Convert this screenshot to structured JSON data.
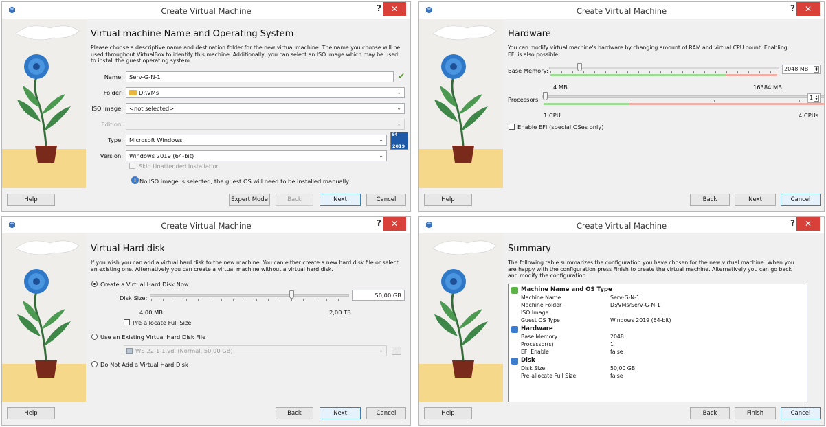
{
  "common": {
    "title": "Create Virtual Machine",
    "help_glyph": "?",
    "close_glyph": "✕",
    "help_button": "Help",
    "back_button": "Back",
    "next_button": "Next",
    "cancel_button": "Cancel",
    "expert_button": "Expert Mode",
    "finish_button": "Finish"
  },
  "w1": {
    "heading": "Virtual machine Name and Operating System",
    "description": "Please choose a descriptive name and destination folder for the new virtual machine. The name you choose will be used throughout VirtualBox to identify this machine. Additionally, you can select an ISO image which may be used to install the guest operating system.",
    "name_label": "Name:",
    "name_value": "Serv-G-N-1",
    "folder_label": "Folder:",
    "folder_value": "D:\\VMs",
    "iso_label": "ISO Image:",
    "iso_value": "<not selected>",
    "edition_label": "Edition:",
    "type_label": "Type:",
    "type_value": "Microsoft Windows",
    "version_label": "Version:",
    "version_value": "Windows 2019 (64-bit)",
    "os_badge_top": "64",
    "os_badge_bottom": "2019",
    "skip_label": "Skip Unattended Installation",
    "info_text": "No ISO image is selected, the guest OS will need to be installed manually."
  },
  "w2": {
    "heading": "Hardware",
    "description": "You can modify virtual machine's hardware by changing amount of RAM and virtual CPU count. Enabling EFI is also possible.",
    "memory_label": "Base Memory:",
    "memory_value": "2048 MB",
    "memory_min": "4 MB",
    "memory_max": "16384 MB",
    "memory_fraction": 0.125,
    "cpu_label": "Processors:",
    "cpu_value": "1",
    "cpu_min": "1 CPU",
    "cpu_max": "4 CPUs",
    "efi_label": "Enable EFI (special OSes only)"
  },
  "w3": {
    "heading": "Virtual Hard disk",
    "description": "If you wish you can add a virtual hard disk to the new machine. You can either create a new hard disk file or select an existing one. Alternatively you can create a virtual machine without a virtual hard disk.",
    "opt_create": "Create a Virtual Hard Disk Now",
    "disk_size_label": "Disk Size:",
    "disk_size_value": "50,00 GB",
    "disk_min": "4,00 MB",
    "disk_max": "2,00 TB",
    "prealloc_label": "Pre-allocate Full Size",
    "opt_existing": "Use an Existing Virtual Hard Disk File",
    "existing_file": "WS-22-1-1.vdi (Normal, 50,00 GB)",
    "opt_none": "Do Not Add a Virtual Hard Disk"
  },
  "w4": {
    "heading": "Summary",
    "description": "The following table summarizes the configuration you have chosen for the new virtual machine. When you are happy with the configuration press Finish to create the virtual machine. Alternatively you can go back and modify the configuration.",
    "sections": [
      {
        "title": "Machine Name and OS Type",
        "icon": "puzzle-icon",
        "rows": [
          {
            "k": "Machine Name",
            "v": "Serv-G-N-1"
          },
          {
            "k": "Machine Folder",
            "v": "D:/VMs/Serv-G-N-1"
          },
          {
            "k": "ISO Image",
            "v": ""
          },
          {
            "k": "Guest OS Type",
            "v": "Windows 2019 (64-bit)"
          }
        ]
      },
      {
        "title": "Hardware",
        "icon": "chip-icon",
        "rows": [
          {
            "k": "Base Memory",
            "v": "2048"
          },
          {
            "k": "Processor(s)",
            "v": "1"
          },
          {
            "k": "EFI Enable",
            "v": "false"
          }
        ]
      },
      {
        "title": "Disk",
        "icon": "disk-icon",
        "rows": [
          {
            "k": "Disk Size",
            "v": "50,00 GB"
          },
          {
            "k": "Pre-allocate Full Size",
            "v": "false"
          }
        ]
      }
    ]
  }
}
